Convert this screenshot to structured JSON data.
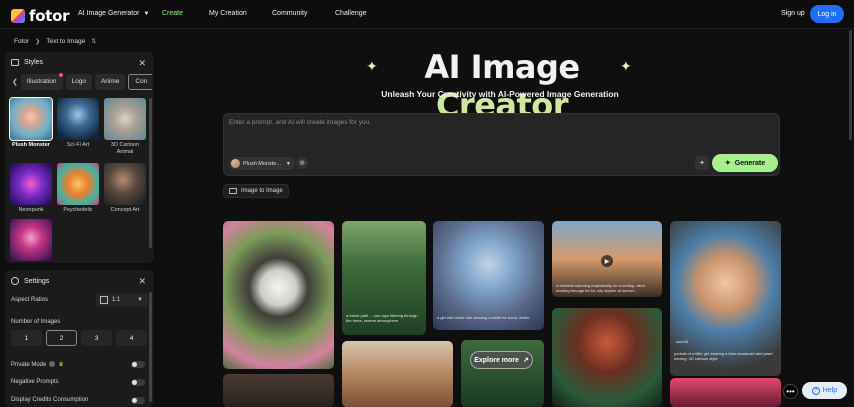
{
  "header": {
    "brand": "fotor",
    "nav": [
      "AI Image Generator",
      "Create",
      "My Creation",
      "Community",
      "Challenge"
    ],
    "signup": "Sign up",
    "login": "Log in",
    "accent_color": "#8ef47c",
    "login_color": "#1f6fff"
  },
  "breadcrumb": {
    "root": "Fotor",
    "current": "Text to Image"
  },
  "styles": {
    "title": "Styles",
    "tabs": [
      "Illustration",
      "Logo",
      "Anime",
      "Con"
    ],
    "items": [
      {
        "label": "Plush Monster",
        "selected": true
      },
      {
        "label": "Sci-Fi Art"
      },
      {
        "label": "3D Cartoon Animal"
      },
      {
        "label": "Neonpunk"
      },
      {
        "label": "Psychedelic"
      },
      {
        "label": "Concept Art"
      },
      {
        "label": ""
      }
    ]
  },
  "settings": {
    "title": "Settings",
    "aspect_label": "Aspect Ratios",
    "aspect_value": "1:1",
    "num_label": "Number of Images",
    "num_options": [
      "1",
      "2",
      "3",
      "4"
    ],
    "num_selected": "2",
    "private_label": "Private Mode",
    "negative_label": "Negative Prompts",
    "credits_label": "Display Credits Consumption"
  },
  "hero": {
    "title_a": "AI Image",
    "title_b": "Creator",
    "subtitle": "Unleash Your Creativity with AI-Powered Image Generation"
  },
  "prompt": {
    "placeholder": "Enter a prompt, and AI will create images for you.",
    "model_chip": "Plush Monste...",
    "generate": "Generate",
    "img2img": "Image to Image"
  },
  "gallery": {
    "explore": "Explore more",
    "captions": [
      "a forest path ... sun rays filtering through the trees, serene atmosphere",
      "a girl with silver hair wearing a white fur hood, winter",
      "A cheetah standing majestically on a rooftop, wind blowing through its fur, city skyline at sunset...",
      "portrait of a little girl wearing a blue headscarf and pearl earring, 3D cartoon style"
    ],
    "user": "user26"
  },
  "help": "Help"
}
